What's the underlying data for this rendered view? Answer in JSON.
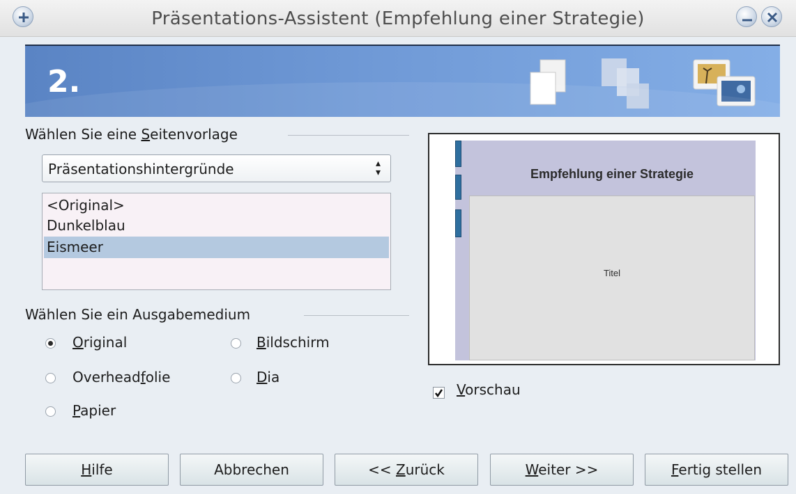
{
  "window": {
    "title": "Präsentations-Assistent (Empfehlung einer Strategie)"
  },
  "banner": {
    "step": "2."
  },
  "template_group": {
    "label_pre": "Wählen Sie eine ",
    "label_mn": "S",
    "label_post": "eitenvorlage",
    "dropdown_value": "Präsentationshintergründe",
    "list_items": [
      "<Original>",
      "Dunkelblau",
      "Eismeer"
    ],
    "selected_item": "Eismeer"
  },
  "medium_group": {
    "label": "Wählen Sie ein Ausgabemedium",
    "options": [
      {
        "pre": "",
        "mn": "O",
        "post": "riginal",
        "checked": true
      },
      {
        "pre": "",
        "mn": "B",
        "post": "ildschirm",
        "checked": false
      },
      {
        "pre": "Overhead",
        "mn": "f",
        "post": "olie",
        "checked": false
      },
      {
        "pre": "",
        "mn": "D",
        "post": "ia",
        "checked": false
      },
      {
        "pre": "",
        "mn": "P",
        "post": "apier",
        "checked": false
      }
    ]
  },
  "preview": {
    "slide_title": "Empfehlung einer Strategie",
    "slide_subtitle": "Titel",
    "check_mn": "V",
    "check_post": "orschau",
    "checked": true
  },
  "buttons": {
    "help": {
      "pre": "",
      "mn": "H",
      "post": "ilfe"
    },
    "cancel": {
      "pre": "Abbrechen",
      "mn": "",
      "post": ""
    },
    "back": {
      "pre": "<< ",
      "mn": "Z",
      "post": "urück"
    },
    "next": {
      "pre": "",
      "mn": "W",
      "post": "eiter >>"
    },
    "finish": {
      "pre": "",
      "mn": "F",
      "post": "ertig stellen"
    }
  },
  "colors": {
    "banner": "#6f99d6",
    "selection": "#b4c9e0",
    "slide_accent": "#2f6f9f"
  }
}
